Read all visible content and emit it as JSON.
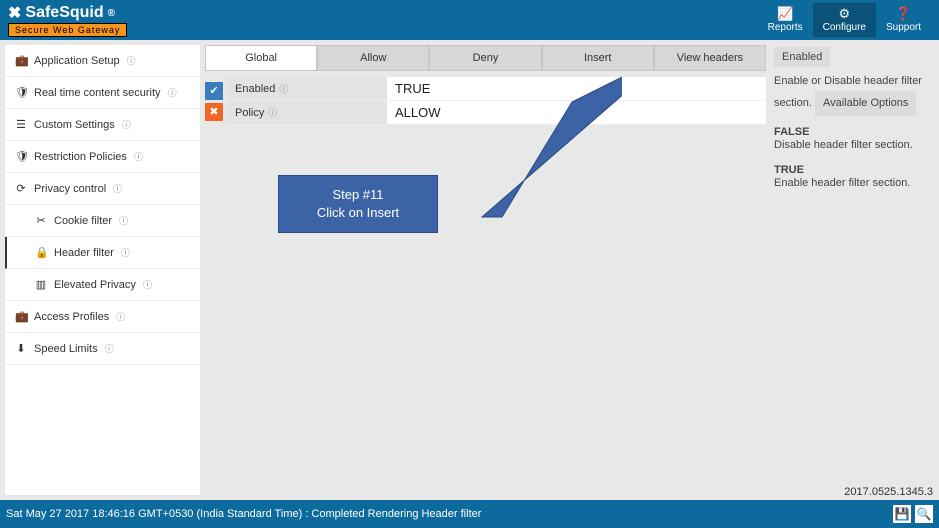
{
  "header": {
    "brand": "SafeSquid",
    "brand_reg": "®",
    "brand_tag": "Secure Web Gateway",
    "actions": {
      "reports": "Reports",
      "configure": "Configure",
      "support": "Support"
    }
  },
  "sidebar": {
    "items": [
      {
        "icon": "briefcase",
        "label": "Application Setup"
      },
      {
        "icon": "shield",
        "label": "Real time content security"
      },
      {
        "icon": "list",
        "label": "Custom Settings"
      },
      {
        "icon": "shield",
        "label": "Restriction Policies"
      },
      {
        "icon": "refresh",
        "label": "Privacy control"
      },
      {
        "icon": "cut",
        "label": "Cookie filter",
        "sub": true
      },
      {
        "icon": "lock",
        "label": "Header filter",
        "sub": true,
        "active": true
      },
      {
        "icon": "bars",
        "label": "Elevated Privacy",
        "sub": true
      },
      {
        "icon": "briefcase",
        "label": "Access Profiles"
      },
      {
        "icon": "download",
        "label": "Speed Limits"
      }
    ]
  },
  "tabs": [
    {
      "label": "Global",
      "active": true
    },
    {
      "label": "Allow"
    },
    {
      "label": "Deny"
    },
    {
      "label": "Insert"
    },
    {
      "label": "View headers"
    }
  ],
  "rows": [
    {
      "key": "Enabled",
      "value": "TRUE"
    },
    {
      "key": "Policy",
      "value": "ALLOW"
    }
  ],
  "right_panel": {
    "badge": "Enabled",
    "desc": "Enable or Disable header filter section.",
    "options_btn": "Available Options",
    "opt_false_title": "FALSE",
    "opt_false_desc": "Disable header filter section.",
    "opt_true_title": "TRUE",
    "opt_true_desc": "Enable header filter section."
  },
  "callout": {
    "line1": "Step #11",
    "line2": "Click on Insert"
  },
  "footer": {
    "status": "Sat May 27 2017 18:46:16 GMT+0530 (India Standard Time) : Completed Rendering Header filter",
    "build": "2017.0525.1345.3"
  }
}
